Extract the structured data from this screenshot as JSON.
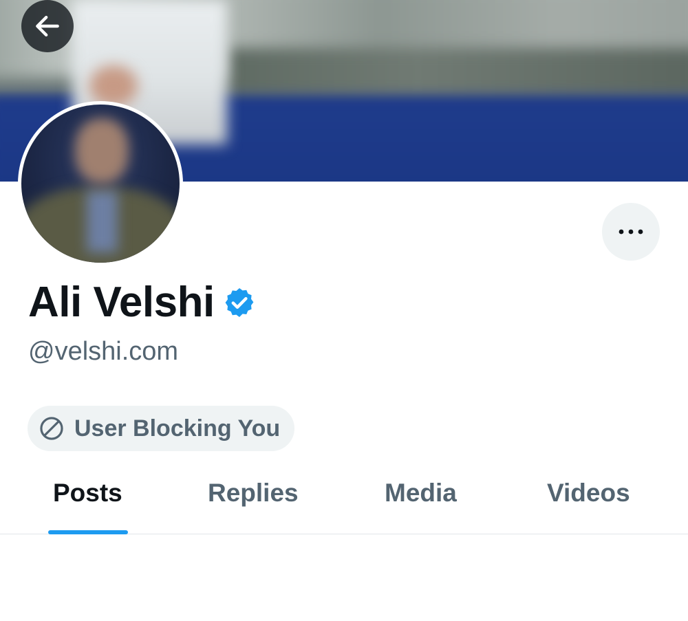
{
  "profile": {
    "name": "Ali Velshi",
    "handle": "@velshi.com",
    "verified": true,
    "status_pill": "User Blocking You"
  },
  "header": {
    "back_icon": "arrow-left-icon",
    "more_icon": "more-horizontal-icon"
  },
  "tabs": [
    {
      "label": "Posts",
      "active": true
    },
    {
      "label": "Replies",
      "active": false
    },
    {
      "label": "Media",
      "active": false
    },
    {
      "label": "Videos",
      "active": false
    }
  ],
  "colors": {
    "accent": "#1d9bf0",
    "text_primary": "#0f1419",
    "text_secondary": "#536471",
    "pill_bg": "#eff3f4",
    "banner_blue": "#1e3a8a"
  }
}
